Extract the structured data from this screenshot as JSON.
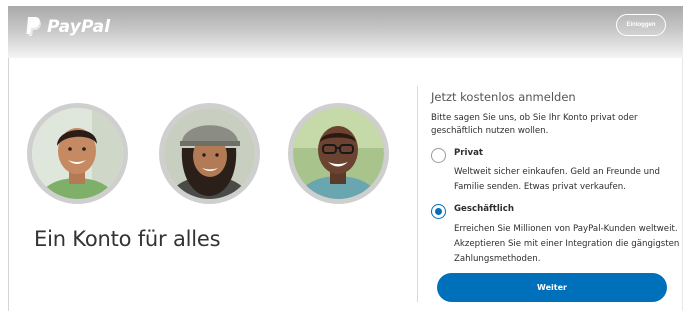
{
  "header": {
    "logo_text": "PayPal",
    "login_label": "Einloggen",
    "colors": {
      "logo": "#ffffff",
      "gradient_top": "#a9a9a9",
      "gradient_bottom": "#f4f4f4"
    }
  },
  "hero": {
    "tagline": "Ein Konto für alles",
    "avatars": [
      "person-photo",
      "person-photo",
      "person-photo"
    ]
  },
  "signup": {
    "title": "Jetzt kostenlos anmelden",
    "description": "Bitte sagen Sie uns, ob Sie Ihr Konto privat oder geschäftlich nutzen wollen.",
    "options": [
      {
        "label": "Privat",
        "selected": false,
        "description": "Weltweit sicher einkaufen. Geld an Freunde und Familie senden. Etwas privat verkaufen."
      },
      {
        "label": "Geschäftlich",
        "selected": true,
        "description": "Erreichen Sie Millionen von PayPal-Kunden weltweit. Akzeptieren Sie mit einer Integration die gängigsten Zahlungsmethoden."
      }
    ],
    "continue_label": "Weiter",
    "accent_color": "#0070ba"
  }
}
